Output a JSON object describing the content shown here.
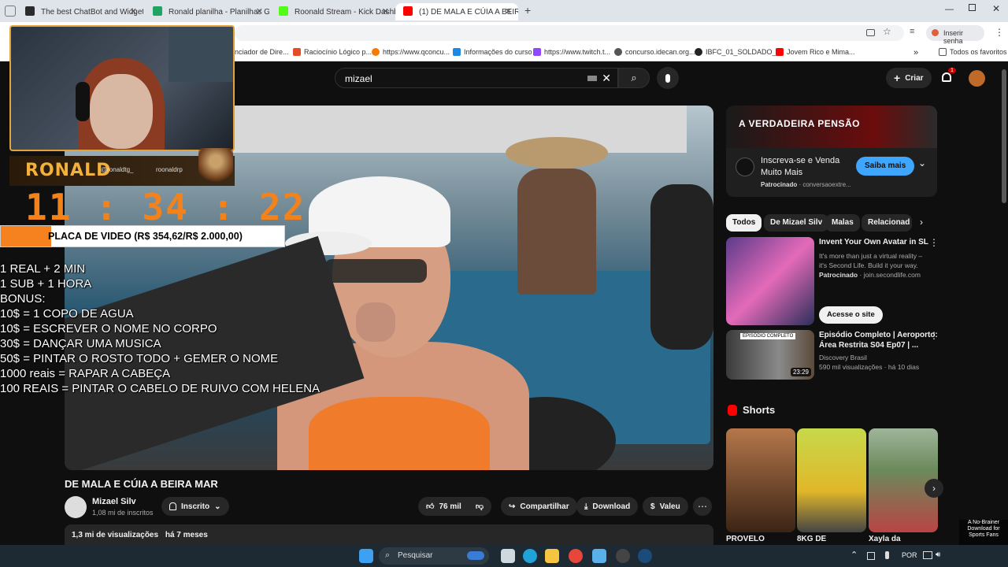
{
  "tabs": [
    {
      "label": "The best ChatBot and Widgets",
      "color": "#2b2b2b"
    },
    {
      "label": "Ronald planilha - Planilhas Goo",
      "color": "#1fa463"
    },
    {
      "label": "Roonald Stream - Kick Dashbo",
      "color": "#53fc18"
    },
    {
      "label": "(1) DE MALA E CÚIA A BEIR",
      "color": "#ff0000"
    }
  ],
  "browser": {
    "insert_password": "Inserir senha",
    "all_bookmarks": "Todos os favoritos"
  },
  "bookmarks": [
    {
      "label": "nciador de Dire...",
      "color": "#888"
    },
    {
      "label": "Raciocínio Lógico p...",
      "color": "#e34c26"
    },
    {
      "label": "https://www.qconcu...",
      "color": "#f57c00"
    },
    {
      "label": "Informações do curso",
      "color": "#1e88e5"
    },
    {
      "label": "https://www.twitch.t...",
      "color": "#9146ff"
    },
    {
      "label": "concurso.idecan.org...",
      "color": "#555"
    },
    {
      "label": "IBFC_01_SOLDADO_...",
      "color": "#222"
    },
    {
      "label": "Jovem Rico e Mima...",
      "color": "#ff0000"
    }
  ],
  "yt": {
    "search_value": "mizael",
    "create_label": "Criar",
    "notif_count": "1",
    "video_title": "DE MALA E CÚIA A BEIRA MAR",
    "channel_name": "Mizael Silv",
    "subscribers": "1,08 mi de inscritos",
    "subscribed_label": "Inscrito",
    "likes": "76 mil",
    "share_label": "Compartilhar",
    "download_label": "Download",
    "thanks_label": "Valeu",
    "views": "1,3 mi de visualizações",
    "posted": "há 7 meses"
  },
  "ad": {
    "banner_text": "A VERDADEIRA PENSÃO",
    "title_line1": "Inscreva-se e Venda",
    "title_line2": "Muito Mais",
    "sponsored": "Patrocinado",
    "domain": "conversaoextre...",
    "cta": "Saiba mais"
  },
  "chips": [
    "Todos",
    "De Mizael Silv",
    "Malas",
    "Relacionad"
  ],
  "recs": [
    {
      "title_line1": "Invent Your Own Avatar in SL",
      "desc_line1": "It's more than just a virtual reality –",
      "desc_line2": "it's Second Life. Build it your way.",
      "sponsored": "Patrocinado",
      "domain": "join.secondlife.com",
      "cta": "Acesse o site"
    },
    {
      "badge": "EPISÓDIO COMPLETO",
      "title_line1": "Episódio Completo | Aeroporto:",
      "title_line2": "Área Restrita S04 Ep07 | ...",
      "channel": "Discovery Brasil",
      "views": "590 mil visualizações",
      "age": "há 10 dias",
      "duration": "23:29"
    }
  ],
  "shorts": {
    "heading": "Shorts",
    "items": [
      {
        "title": "PROVELO"
      },
      {
        "title": "8KG DE"
      },
      {
        "title": "Xayla da"
      }
    ]
  },
  "overlay": {
    "logo": "RONALD",
    "handle1": "@ronaldtg_",
    "handle2": "roonaldrp",
    "timer": "11 : 34 : 22",
    "goal_text": "PLACA DE VIDEO (R$ 354,62/R$ 2.000,00)",
    "goal_progress": 0.1773,
    "rules": [
      "1 REAL + 2 MIN",
      "1 SUB + 1 HORA",
      "BONUS:",
      "10$ = 1 COPO DE AGUA",
      "10$ = ESCREVER O NOME NO CORPO",
      "30$ = DANÇAR UMA MUSICA",
      "50$ = PINTAR O ROSTO TODO + GEMER O NOME",
      "1000 reais = RAPAR A CABEÇA",
      "100 REAIS = PINTAR O CABELO DE RUIVO COM HELENA"
    ]
  },
  "taskbar": {
    "search_label": "Pesquisar",
    "lang": "POR"
  },
  "promo": {
    "line1": "A No-Brainer",
    "line2": "Download for",
    "line3": "Sports Fans"
  }
}
